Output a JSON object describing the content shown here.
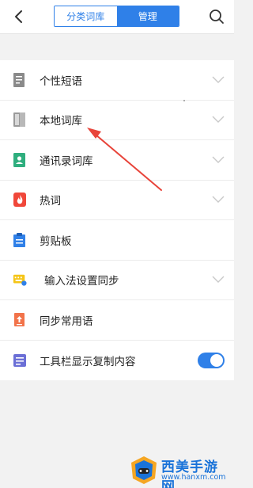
{
  "header": {
    "tabs": [
      {
        "label": "分类词库",
        "active": false
      },
      {
        "label": "管理",
        "active": true
      }
    ]
  },
  "colors": {
    "accent": "#2f80e8",
    "arrow": "#e8443a"
  },
  "settings": [
    {
      "label": "个性短语",
      "icon": "document-icon",
      "control": "chevron"
    },
    {
      "label": "本地词库",
      "icon": "book-icon",
      "control": "chevron"
    },
    {
      "label": "通讯录词库",
      "icon": "contacts-book-icon",
      "control": "chevron"
    },
    {
      "label": "热词",
      "icon": "fire-icon",
      "control": "chevron"
    },
    {
      "label": "剪贴板",
      "icon": "clipboard-icon",
      "control": "none"
    },
    {
      "label": "输入法设置同步",
      "icon": "keyboard-sync-icon",
      "control": "chevron"
    },
    {
      "label": "同步常用语",
      "icon": "upload-doc-icon",
      "control": "none"
    },
    {
      "label": "工具栏显示复制内容",
      "icon": "toolbar-copy-icon",
      "control": "toggle",
      "toggle_on": true
    }
  ],
  "watermark": {
    "name": "西美手游网",
    "url": "www.hanxm.com"
  }
}
